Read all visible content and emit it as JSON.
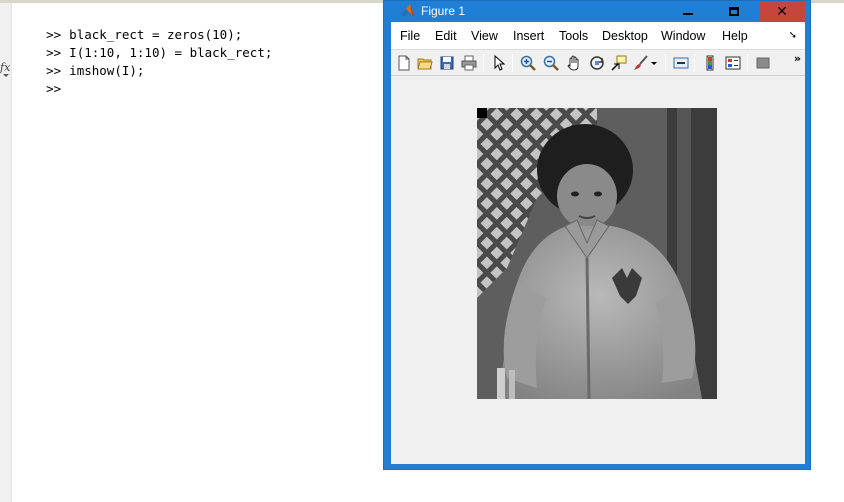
{
  "command_window": {
    "prompt": ">>",
    "lines": [
      "black_rect = zeros(10);",
      "I(1:10, 1:10) = black_rect;",
      "imshow(I);",
      ""
    ],
    "fx_label": "fx"
  },
  "figure_window": {
    "title": "Figure 1",
    "menu": [
      "File",
      "Edit",
      "View",
      "Insert",
      "Tools",
      "Desktop",
      "Window",
      "Help"
    ],
    "toolbar_icons": [
      "new-figure-icon",
      "open-file-icon",
      "save-icon",
      "print-icon",
      "select-arrow-icon",
      "zoom-in-icon",
      "zoom-out-icon",
      "pan-hand-icon",
      "rotate-3d-icon",
      "data-cursor-icon",
      "brush-icon",
      "link-plot-icon",
      "colorbar-icon",
      "legend-icon",
      "property-editor-icon"
    ],
    "image_content": "grayscale photo with black square at top-left",
    "colors": {
      "titlebar": "#1f7fd4",
      "close_button": "#c7463c",
      "client_background": "#f0f0f0"
    }
  }
}
